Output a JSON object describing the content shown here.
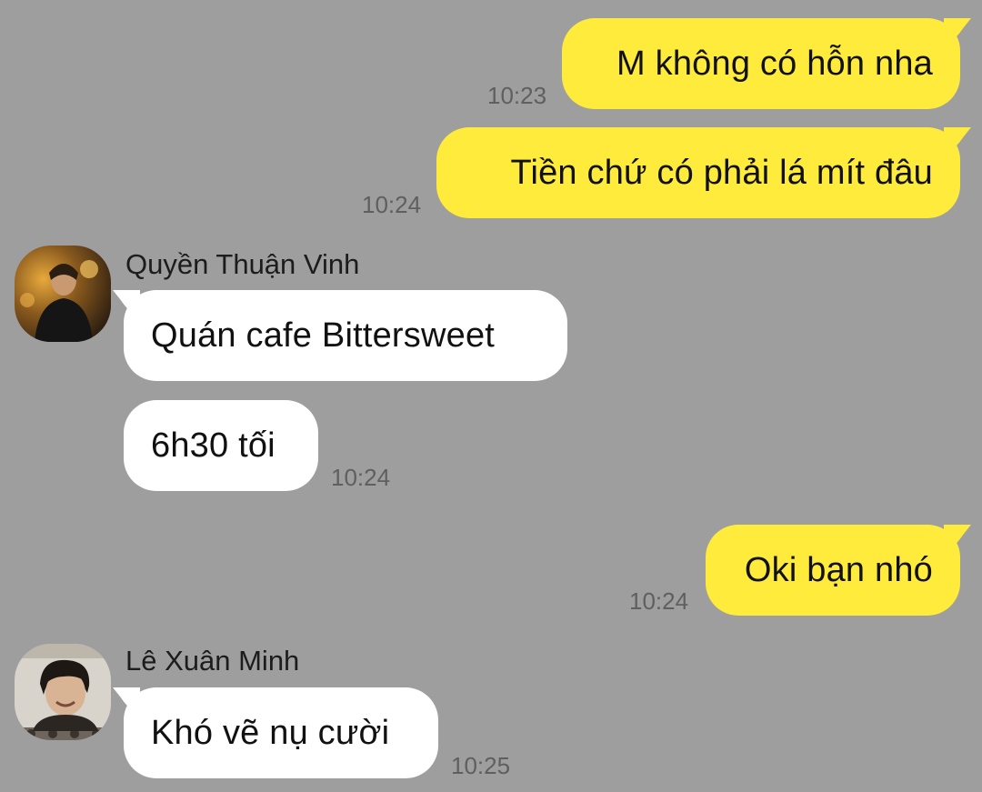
{
  "chat": {
    "messages": [
      {
        "direction": "outgoing",
        "text": "M không có hỗn nha",
        "time": "10:23"
      },
      {
        "direction": "outgoing",
        "text": "Tiền chứ có phải lá mít đâu",
        "time": "10:24"
      },
      {
        "direction": "incoming",
        "sender": "Quyền Thuận Vinh",
        "text": "Quán cafe Bittersweet"
      },
      {
        "direction": "incoming",
        "text": "6h30 tối",
        "time": "10:24"
      },
      {
        "direction": "outgoing",
        "text": "Oki bạn nhó",
        "time": "10:24"
      },
      {
        "direction": "incoming",
        "sender": "Lê Xuân Minh",
        "text": "Khó vẽ nụ cười",
        "time": "10:25"
      }
    ]
  },
  "colors": {
    "background": "#9e9e9e",
    "outgoing_bubble": "#ffeb3b",
    "incoming_bubble": "#ffffff",
    "timestamp": "#5f5f5f"
  },
  "icons": {
    "avatar_1": "user-avatar-photo",
    "avatar_2": "user-avatar-photo"
  }
}
